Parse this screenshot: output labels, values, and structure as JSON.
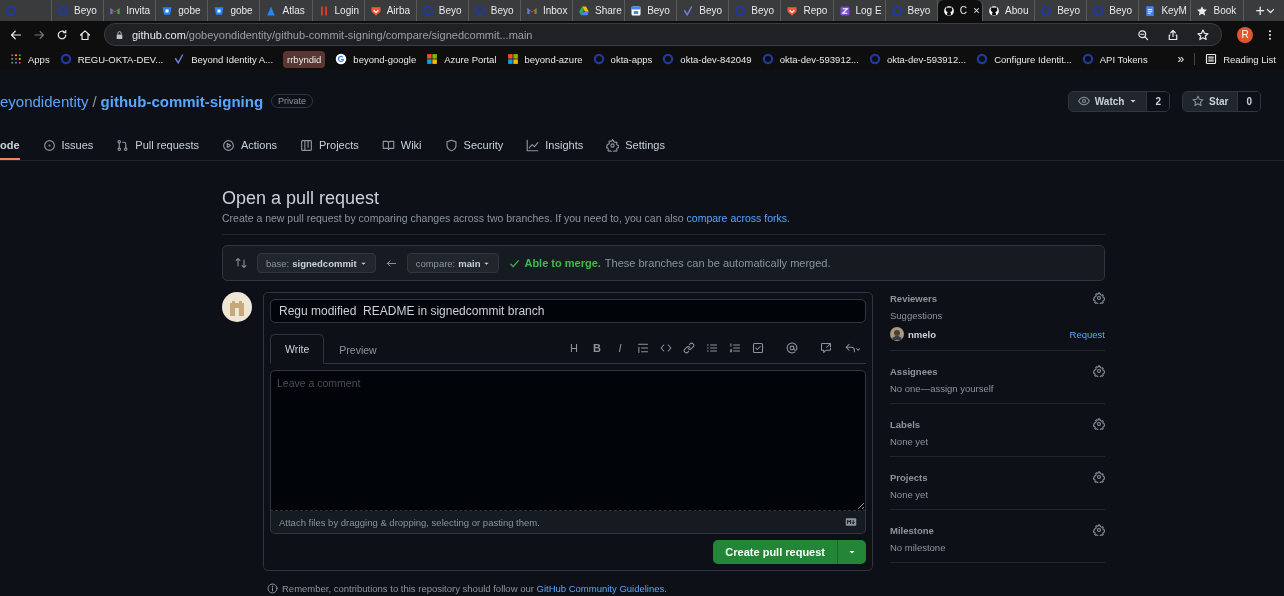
{
  "browser": {
    "tabs": [
      {
        "selected": false
      },
      {
        "title": "Beyo",
        "selected": false
      },
      {
        "title": "Invita",
        "selected": false
      },
      {
        "title": "gobe",
        "selected": false
      },
      {
        "title": "gobe",
        "selected": false
      },
      {
        "title": "Atlas",
        "selected": false
      },
      {
        "title": "Login",
        "selected": false
      },
      {
        "title": "Airba",
        "selected": false
      },
      {
        "title": "Beyo",
        "selected": false
      },
      {
        "title": "Beyo",
        "selected": false
      },
      {
        "title": "Inbox",
        "selected": false
      },
      {
        "title": "Share",
        "selected": false
      },
      {
        "title": "Beyo",
        "selected": false
      },
      {
        "title": "Beyo",
        "selected": false
      },
      {
        "title": "Beyo",
        "selected": false
      },
      {
        "title": "Repo",
        "selected": false
      },
      {
        "title": "Log E",
        "selected": false
      },
      {
        "title": "Beyo",
        "selected": false
      },
      {
        "title": "C",
        "selected": true
      },
      {
        "title": "Abou",
        "selected": false
      },
      {
        "title": "Beyo",
        "selected": false
      },
      {
        "title": "Beyo",
        "selected": false
      },
      {
        "title": "KeyM",
        "selected": false
      },
      {
        "title": "Book",
        "selected": false
      }
    ],
    "new_tab": "+",
    "url_host": "github.com",
    "url_path": "/gobeyondidentity/github-commit-signing/compare/signedcommit...main",
    "profile": "R",
    "bookmarks": [
      "Apps",
      "REGU-OKTA-DEV...",
      "Beyond Identity A...",
      "rrbyndid",
      "beyond-google",
      "Azure Portal",
      "beyond-azure",
      "okta-apps",
      "okta-dev-842049",
      "okta-dev-593912...",
      "okta-dev-593912...",
      "Configure  Identit...",
      "API Tokens"
    ],
    "more": "»",
    "reading_list": "Reading List"
  },
  "repo": {
    "owner": "eyondidentity",
    "separator": "/",
    "name": "github-commit-signing",
    "visibility": "Private",
    "watch": {
      "label": "Watch",
      "count": "2"
    },
    "star": {
      "label": "Star",
      "count": "0"
    }
  },
  "nav": [
    {
      "label": "ode",
      "selected": true
    },
    {
      "label": "Issues",
      "selected": false
    },
    {
      "label": "Pull requests",
      "selected": false
    },
    {
      "label": "Actions",
      "selected": false
    },
    {
      "label": "Projects",
      "selected": false
    },
    {
      "label": "Wiki",
      "selected": false
    },
    {
      "label": "Security",
      "selected": false
    },
    {
      "label": "Insights",
      "selected": false
    },
    {
      "label": "Settings",
      "selected": false
    }
  ],
  "page": {
    "title": "Open a pull request",
    "subtitle": "Create a new pull request by comparing changes across two branches. If you need to, you can also ",
    "subtitle_link": "compare across forks",
    "subtitle_end": ".",
    "base": {
      "prefix": "base: ",
      "branch": "signedcommit"
    },
    "compare": {
      "prefix": "compare: ",
      "branch": "main"
    },
    "merge_status": "Able to merge.",
    "merge_note": "These branches can be automatically merged.",
    "pr_title": "Regu modified  README in signedcommit branch",
    "editor_tabs": [
      {
        "label": "Write",
        "selected": true
      },
      {
        "label": "Preview",
        "selected": false
      }
    ],
    "toolbar": [
      {
        "kind": "text",
        "label": "H"
      },
      {
        "kind": "bold",
        "label": "B"
      },
      {
        "kind": "italic",
        "label": "I"
      },
      {
        "kind": "quote"
      },
      {
        "kind": "code"
      },
      {
        "kind": "link"
      },
      {
        "kind": "bullets"
      },
      {
        "kind": "numbers"
      },
      {
        "kind": "tasks"
      },
      {
        "kind": "mention"
      },
      {
        "kind": "reference"
      },
      {
        "kind": "reply"
      }
    ],
    "comment_placeholder": "Leave a comment",
    "attach_hint": "Attach files by dragging & dropping, selecting or pasting them.",
    "submit": "Create pull request",
    "footer": "Remember, contributions to this repository should follow our ",
    "footer_link": "GitHub Community Guidelines",
    "footer_end": "."
  },
  "sidebar": [
    {
      "heading": "Reviewers",
      "note": "Suggestions",
      "reviewer": "nmelo",
      "action": "Request"
    },
    {
      "heading": "Assignees",
      "note": "No one—assign yourself"
    },
    {
      "heading": "Labels",
      "note": "None yet"
    },
    {
      "heading": "Projects",
      "note": "None yet"
    },
    {
      "heading": "Milestone",
      "note": "No milestone"
    }
  ]
}
